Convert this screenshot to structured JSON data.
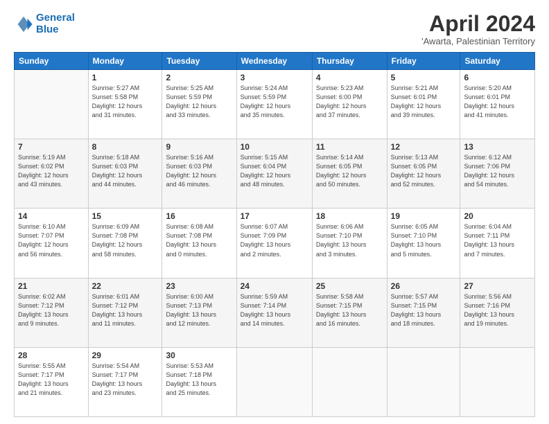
{
  "logo": {
    "line1": "General",
    "line2": "Blue"
  },
  "title": "April 2024",
  "location": "'Awarta, Palestinian Territory",
  "weekdays": [
    "Sunday",
    "Monday",
    "Tuesday",
    "Wednesday",
    "Thursday",
    "Friday",
    "Saturday"
  ],
  "weeks": [
    [
      {
        "num": "",
        "info": ""
      },
      {
        "num": "1",
        "info": "Sunrise: 5:27 AM\nSunset: 5:58 PM\nDaylight: 12 hours\nand 31 minutes."
      },
      {
        "num": "2",
        "info": "Sunrise: 5:25 AM\nSunset: 5:59 PM\nDaylight: 12 hours\nand 33 minutes."
      },
      {
        "num": "3",
        "info": "Sunrise: 5:24 AM\nSunset: 5:59 PM\nDaylight: 12 hours\nand 35 minutes."
      },
      {
        "num": "4",
        "info": "Sunrise: 5:23 AM\nSunset: 6:00 PM\nDaylight: 12 hours\nand 37 minutes."
      },
      {
        "num": "5",
        "info": "Sunrise: 5:21 AM\nSunset: 6:01 PM\nDaylight: 12 hours\nand 39 minutes."
      },
      {
        "num": "6",
        "info": "Sunrise: 5:20 AM\nSunset: 6:01 PM\nDaylight: 12 hours\nand 41 minutes."
      }
    ],
    [
      {
        "num": "7",
        "info": "Sunrise: 5:19 AM\nSunset: 6:02 PM\nDaylight: 12 hours\nand 43 minutes."
      },
      {
        "num": "8",
        "info": "Sunrise: 5:18 AM\nSunset: 6:03 PM\nDaylight: 12 hours\nand 44 minutes."
      },
      {
        "num": "9",
        "info": "Sunrise: 5:16 AM\nSunset: 6:03 PM\nDaylight: 12 hours\nand 46 minutes."
      },
      {
        "num": "10",
        "info": "Sunrise: 5:15 AM\nSunset: 6:04 PM\nDaylight: 12 hours\nand 48 minutes."
      },
      {
        "num": "11",
        "info": "Sunrise: 5:14 AM\nSunset: 6:05 PM\nDaylight: 12 hours\nand 50 minutes."
      },
      {
        "num": "12",
        "info": "Sunrise: 5:13 AM\nSunset: 6:05 PM\nDaylight: 12 hours\nand 52 minutes."
      },
      {
        "num": "13",
        "info": "Sunrise: 6:12 AM\nSunset: 7:06 PM\nDaylight: 12 hours\nand 54 minutes."
      }
    ],
    [
      {
        "num": "14",
        "info": "Sunrise: 6:10 AM\nSunset: 7:07 PM\nDaylight: 12 hours\nand 56 minutes."
      },
      {
        "num": "15",
        "info": "Sunrise: 6:09 AM\nSunset: 7:08 PM\nDaylight: 12 hours\nand 58 minutes."
      },
      {
        "num": "16",
        "info": "Sunrise: 6:08 AM\nSunset: 7:08 PM\nDaylight: 13 hours\nand 0 minutes."
      },
      {
        "num": "17",
        "info": "Sunrise: 6:07 AM\nSunset: 7:09 PM\nDaylight: 13 hours\nand 2 minutes."
      },
      {
        "num": "18",
        "info": "Sunrise: 6:06 AM\nSunset: 7:10 PM\nDaylight: 13 hours\nand 3 minutes."
      },
      {
        "num": "19",
        "info": "Sunrise: 6:05 AM\nSunset: 7:10 PM\nDaylight: 13 hours\nand 5 minutes."
      },
      {
        "num": "20",
        "info": "Sunrise: 6:04 AM\nSunset: 7:11 PM\nDaylight: 13 hours\nand 7 minutes."
      }
    ],
    [
      {
        "num": "21",
        "info": "Sunrise: 6:02 AM\nSunset: 7:12 PM\nDaylight: 13 hours\nand 9 minutes."
      },
      {
        "num": "22",
        "info": "Sunrise: 6:01 AM\nSunset: 7:12 PM\nDaylight: 13 hours\nand 11 minutes."
      },
      {
        "num": "23",
        "info": "Sunrise: 6:00 AM\nSunset: 7:13 PM\nDaylight: 13 hours\nand 12 minutes."
      },
      {
        "num": "24",
        "info": "Sunrise: 5:59 AM\nSunset: 7:14 PM\nDaylight: 13 hours\nand 14 minutes."
      },
      {
        "num": "25",
        "info": "Sunrise: 5:58 AM\nSunset: 7:15 PM\nDaylight: 13 hours\nand 16 minutes."
      },
      {
        "num": "26",
        "info": "Sunrise: 5:57 AM\nSunset: 7:15 PM\nDaylight: 13 hours\nand 18 minutes."
      },
      {
        "num": "27",
        "info": "Sunrise: 5:56 AM\nSunset: 7:16 PM\nDaylight: 13 hours\nand 19 minutes."
      }
    ],
    [
      {
        "num": "28",
        "info": "Sunrise: 5:55 AM\nSunset: 7:17 PM\nDaylight: 13 hours\nand 21 minutes."
      },
      {
        "num": "29",
        "info": "Sunrise: 5:54 AM\nSunset: 7:17 PM\nDaylight: 13 hours\nand 23 minutes."
      },
      {
        "num": "30",
        "info": "Sunrise: 5:53 AM\nSunset: 7:18 PM\nDaylight: 13 hours\nand 25 minutes."
      },
      {
        "num": "",
        "info": ""
      },
      {
        "num": "",
        "info": ""
      },
      {
        "num": "",
        "info": ""
      },
      {
        "num": "",
        "info": ""
      }
    ]
  ]
}
